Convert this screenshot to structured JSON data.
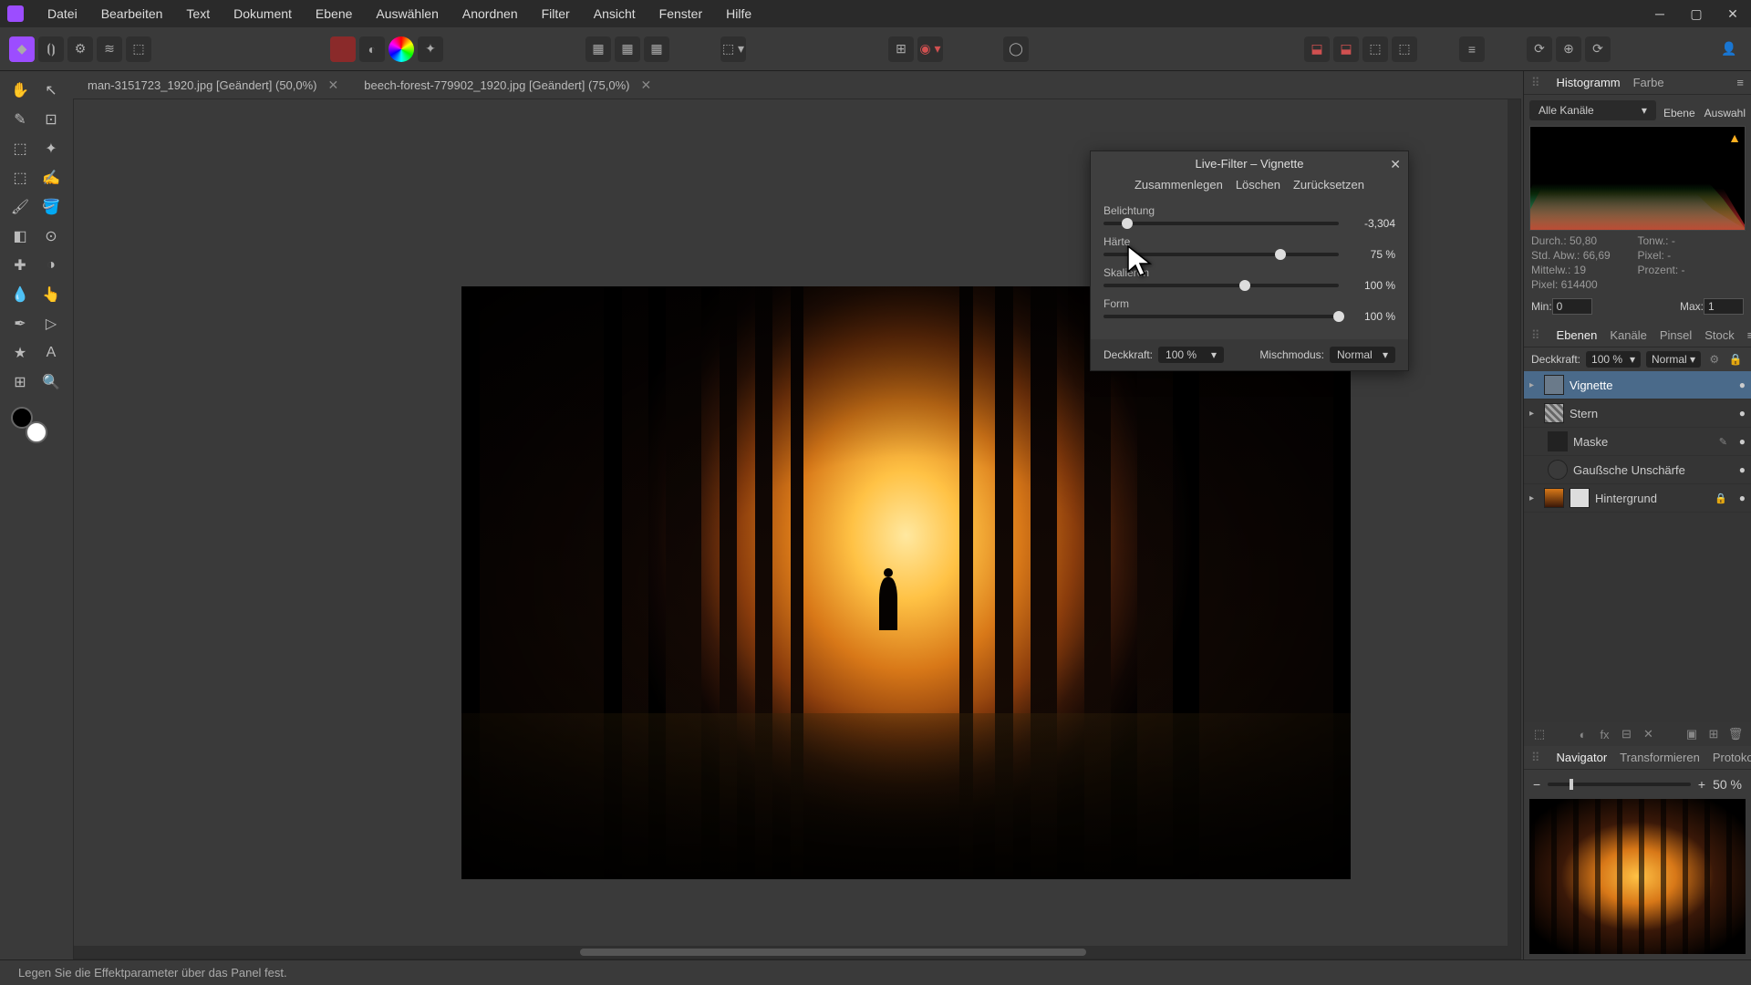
{
  "menu": {
    "items": [
      "Datei",
      "Bearbeiten",
      "Text",
      "Dokument",
      "Ebene",
      "Auswählen",
      "Anordnen",
      "Filter",
      "Ansicht",
      "Fenster",
      "Hilfe"
    ]
  },
  "tabs": [
    {
      "label": "man-3151723_1920.jpg [Geändert] (50,0%)"
    },
    {
      "label": "beech-forest-779902_1920.jpg [Geändert] (75,0%)"
    }
  ],
  "dialog": {
    "title": "Live-Filter – Vignette",
    "actions": {
      "merge": "Zusammenlegen",
      "delete": "Löschen",
      "reset": "Zurücksetzen"
    },
    "sliders": [
      {
        "label": "Belichtung",
        "value": "-3,304",
        "pos": 10
      },
      {
        "label": "Härte",
        "value": "75 %",
        "pos": 75
      },
      {
        "label": "Skalieren",
        "value": "100 %",
        "pos": 60
      },
      {
        "label": "Form",
        "value": "100 %",
        "pos": 100
      }
    ],
    "opacity_label": "Deckkraft:",
    "opacity_value": "100 %",
    "blend_label": "Mischmodus:",
    "blend_value": "Normal"
  },
  "histogram": {
    "tab1": "Histogramm",
    "tab2": "Farbe",
    "channel": "Alle Kanäle",
    "subtabs": {
      "ebene": "Ebene",
      "auswahl": "Auswahl"
    },
    "stats": {
      "durch": "Durch.: 50,80",
      "stdabw": "Std. Abw.: 66,69",
      "mittelw": "Mittelw.: 19",
      "pixel": "Pixel: 614400",
      "tone": "Tonw.: -",
      "pixel2": "Pixel: -",
      "prozent": "Prozent: -"
    },
    "min_lbl": "Min:",
    "min": "0",
    "max_lbl": "Max:",
    "max": "1"
  },
  "layers_panel": {
    "tabs": [
      "Ebenen",
      "Kanäle",
      "Pinsel",
      "Stock"
    ],
    "opacity_label": "Deckkraft:",
    "opacity_value": "100 %",
    "blend_value": "Normal",
    "layers": [
      {
        "name": "Vignette",
        "selected": true,
        "indent": 0
      },
      {
        "name": "Stern",
        "indent": 0
      },
      {
        "name": "Maske",
        "indent": 1,
        "editable": true
      },
      {
        "name": "Gaußsche Unschärfe",
        "indent": 1
      },
      {
        "name": "Hintergrund",
        "indent": 0,
        "locked": true,
        "hasimg": true
      }
    ]
  },
  "navigator": {
    "tabs": [
      "Navigator",
      "Transformieren",
      "Protokoll"
    ],
    "zoom": "50 %"
  },
  "statusbar": "Legen Sie die Effektparameter über das Panel fest."
}
